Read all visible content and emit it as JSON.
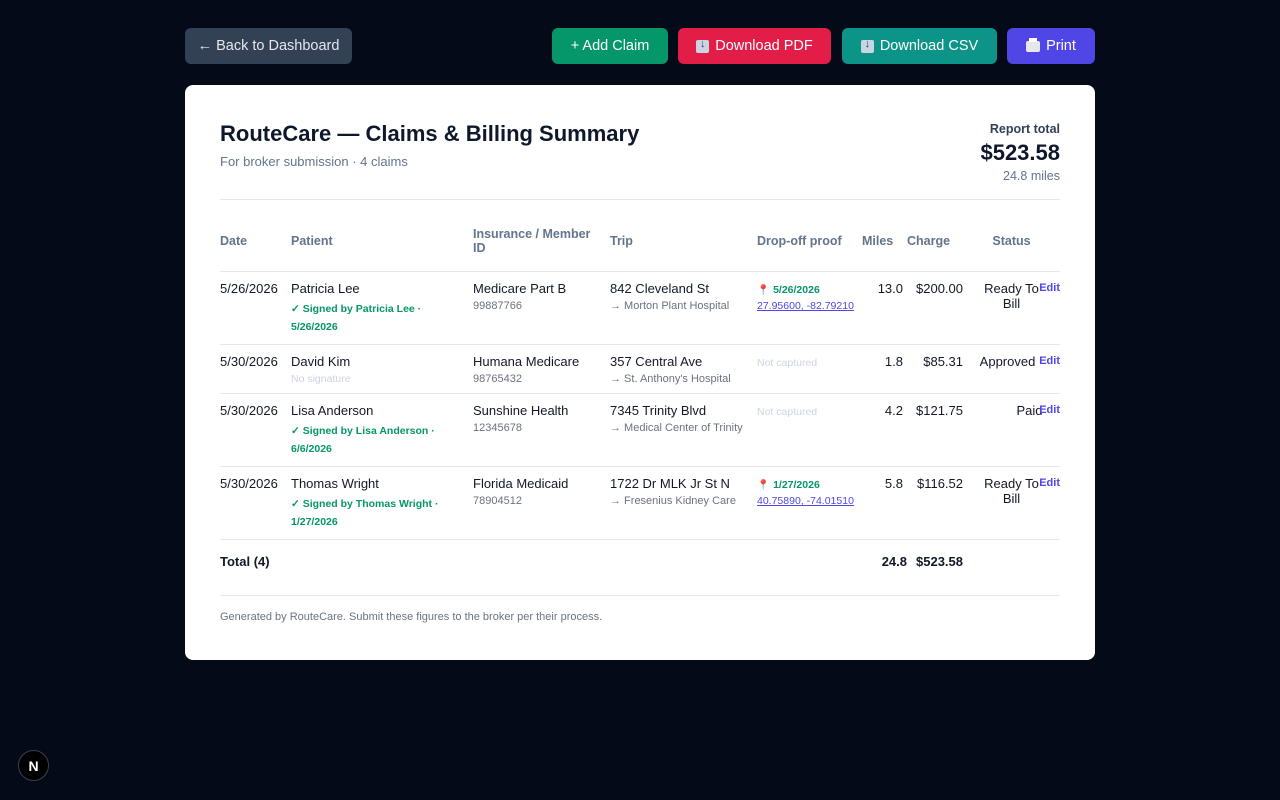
{
  "toolbar": {
    "back_label": "← Back to Dashboard",
    "add_label": "+ Add Claim",
    "pdf_label": "Download PDF",
    "csv_label": "Download CSV",
    "print_label": "Print"
  },
  "report": {
    "title": "RouteCare — Claims & Billing Summary",
    "subtitle": "For broker submission · 4 claims",
    "total_label": "Report total",
    "total_amount": "$523.58",
    "total_miles": "24.8 miles"
  },
  "table": {
    "headers": {
      "date": "Date",
      "patient": "Patient",
      "insurance": "Insurance / Member ID",
      "trip": "Trip",
      "proof": "Drop-off proof",
      "miles": "Miles",
      "charge": "Charge",
      "status": "Status"
    },
    "rows": [
      {
        "date": "5/26/2026",
        "patient": "Patricia Lee",
        "signature": "✓ Signed by Patricia Lee · 5/26/2026",
        "insurance": "Medicare Part B",
        "member_id": "99887766",
        "trip_from": "842 Cleveland St",
        "trip_to": "→ Morton Plant Hospital",
        "proof_date": "5/26/2026",
        "proof_coords": "27.95600, -82.79210",
        "miles": "13.0",
        "charge": "$200.00",
        "status": "Ready To Bill",
        "edit": "Edit"
      },
      {
        "date": "5/30/2026",
        "patient": "David Kim",
        "signature": "No signature",
        "insurance": "Humana Medicare",
        "member_id": "98765432",
        "trip_from": "357 Central Ave",
        "trip_to": "→ St. Anthony's Hospital",
        "proof_none": "Not captured",
        "miles": "1.8",
        "charge": "$85.31",
        "status": "Approved",
        "edit": "Edit"
      },
      {
        "date": "5/30/2026",
        "patient": "Lisa Anderson",
        "signature": "✓ Signed by Lisa Anderson · 6/6/2026",
        "insurance": "Sunshine Health",
        "member_id": "12345678",
        "trip_from": "7345 Trinity Blvd",
        "trip_to": "→ Medical Center of Trinity",
        "proof_none": "Not captured",
        "miles": "4.2",
        "charge": "$121.75",
        "status": "Paid",
        "edit": "Edit"
      },
      {
        "date": "5/30/2026",
        "patient": "Thomas Wright",
        "signature": "✓ Signed by Thomas Wright · 1/27/2026",
        "insurance": "Florida Medicaid",
        "member_id": "78904512",
        "trip_from": "1722 Dr MLK Jr St N",
        "trip_to": "→ Fresenius Kidney Care",
        "proof_date": "1/27/2026",
        "proof_coords": "40.75890, -74.01510",
        "miles": "5.8",
        "charge": "$116.52",
        "status": "Ready To Bill",
        "edit": "Edit"
      }
    ],
    "total": {
      "label": "Total (4)",
      "miles": "24.8",
      "charge": "$523.58"
    }
  },
  "footer": "Generated by RouteCare. Submit these figures to the broker per their process.",
  "badge": "N",
  "colors": {
    "page_bg": "#050a19",
    "back_button": "#334155",
    "add_button": "#059669",
    "pdf_button": "#e11d48",
    "csv_button": "#0d9488",
    "print_button": "#4f46e5",
    "signed_green": "#059669",
    "link_indigo": "#4f46e5"
  }
}
